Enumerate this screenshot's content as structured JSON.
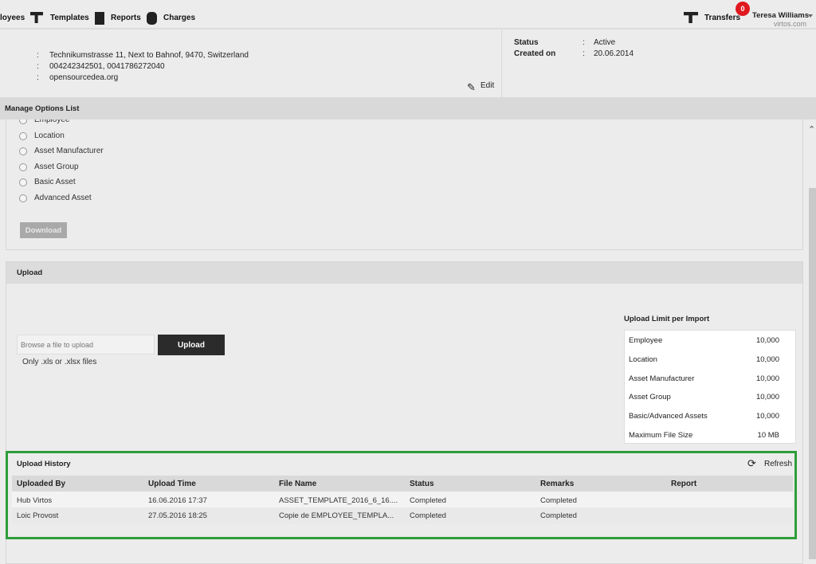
{
  "nav": {
    "items": [
      {
        "label": "loyees"
      },
      {
        "label": "Templates",
        "icon": "templates-icon"
      },
      {
        "label": "Reports",
        "icon": "reports-icon"
      },
      {
        "label": "Charges",
        "icon": "charges-icon"
      }
    ],
    "transfers": "Transfers",
    "badge": "0",
    "user_name": "Teresa Williams",
    "user_domain": "virtos.com"
  },
  "info": {
    "address": "Technikumstrasse 11, Next to Bahnof, 9470, Switzerland",
    "phone": "004242342501, 0041786272040",
    "website": "opensourcedea.org",
    "edit": "Edit",
    "status_label": "Status",
    "status_value": "Active",
    "created_label": "Created on",
    "created_value": "20.06.2014",
    "sep": ":"
  },
  "options": {
    "title": "Manage Options List",
    "items": [
      "Employee",
      "Location",
      "Asset Manufacturer",
      "Asset Group",
      "Basic Asset",
      "Advanced Asset"
    ],
    "download": "Download"
  },
  "upload": {
    "title": "Upload",
    "placeholder": "Browse a file to upload",
    "button": "Upload",
    "hint": "Only .xls or .xlsx files",
    "limit_title": "Upload Limit per Import",
    "limits": [
      {
        "name": "Employee",
        "value": "10,000"
      },
      {
        "name": "Location",
        "value": "10,000"
      },
      {
        "name": "Asset Manufacturer",
        "value": "10,000"
      },
      {
        "name": "Asset Group",
        "value": "10,000"
      },
      {
        "name": "Basic/Advanced Assets",
        "value": "10,000"
      },
      {
        "name": "Maximum File Size",
        "value": "10 MB"
      }
    ]
  },
  "history": {
    "title": "Upload History",
    "refresh": "Refresh",
    "highlight_color": "#2e9e3a",
    "columns": [
      "Uploaded By",
      "Upload Time",
      "File Name",
      "Status",
      "Remarks",
      "Report"
    ],
    "rows": [
      [
        "Hub Virtos",
        "16.06.2016 17:37",
        "ASSET_TEMPLATE_2016_6_16....",
        "Completed",
        "Completed",
        ""
      ],
      [
        "Loic Provost",
        "27.05.2016 18:25",
        "Copie de EMPLOYEE_TEMPLA...",
        "Completed",
        "Completed",
        ""
      ]
    ]
  }
}
